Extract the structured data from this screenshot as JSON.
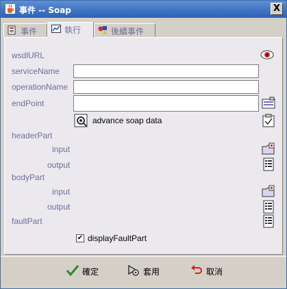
{
  "window": {
    "title": "事件 -- Soap",
    "close_label": "X"
  },
  "tabs": [
    {
      "label": "事件",
      "icon": "document-icon"
    },
    {
      "label": "執行",
      "icon": "chart-icon",
      "active": true
    },
    {
      "label": "後續事件",
      "icon": "shapes-icon"
    }
  ],
  "form": {
    "wsdl_label": "wsdlURL",
    "service_label": "serviceName",
    "service_value": "",
    "operation_label": "operationName",
    "operation_value": "",
    "endpoint_label": "endPoint",
    "endpoint_value": "",
    "advance_label": "advance soap data",
    "header_label": "headerPart",
    "header_input_label": "input",
    "header_output_label": "output",
    "body_label": "bodyPart",
    "body_input_label": "input",
    "body_output_label": "output",
    "fault_label": "faultPart",
    "display_fault_label": "displayFaultPart",
    "display_fault_checked": "✔"
  },
  "buttons": {
    "ok": "確定",
    "apply": "套用",
    "cancel": "取消"
  },
  "colors": {
    "label": "#6e6e9e",
    "panel": "#ebe9ed",
    "titlebar": "#2b61b5"
  }
}
